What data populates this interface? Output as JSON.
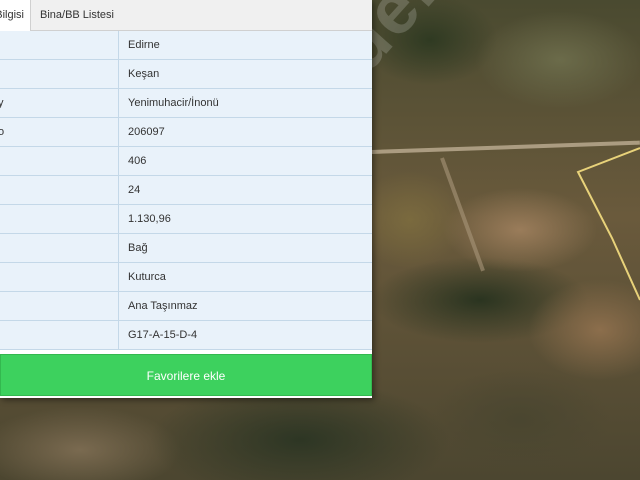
{
  "tabs": [
    {
      "label": "Bilgisi"
    },
    {
      "label": "Bina/BB Listesi"
    }
  ],
  "rows": [
    {
      "key": "",
      "value": "Edirne"
    },
    {
      "key": "",
      "value": "Keşan"
    },
    {
      "key": "y",
      "value": "Yenimuhacir/İnonü"
    },
    {
      "key": "o",
      "value": "206097"
    },
    {
      "key": "",
      "value": "406"
    },
    {
      "key": "",
      "value": "24"
    },
    {
      "key": "",
      "value": "1.130,96"
    },
    {
      "key": "",
      "value": "Bağ"
    },
    {
      "key": "",
      "value": "Kuturca"
    },
    {
      "key": "",
      "value": "Ana Taşınmaz"
    },
    {
      "key": "",
      "value": "G17-A-15-D-4"
    }
  ],
  "favorite_button": {
    "label": "Favorilere ekle"
  },
  "watermark": {
    "text": "sahibinden"
  },
  "colors": {
    "button_bg": "#3dd15e",
    "row_bg": "#e9f2fa",
    "parcel_outline": "#e8d27a"
  }
}
